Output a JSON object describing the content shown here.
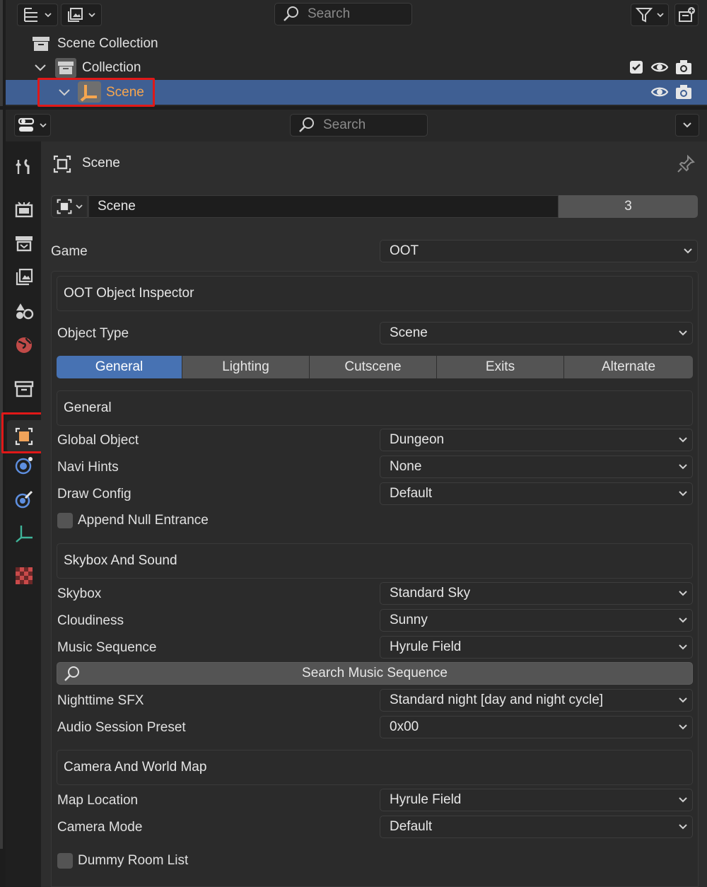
{
  "outliner": {
    "search_placeholder": "Search",
    "tree": [
      {
        "label": "Scene Collection"
      },
      {
        "label": "Collection"
      },
      {
        "label": "Scene"
      }
    ]
  },
  "properties": {
    "search_placeholder": "Search",
    "context_title": "Scene",
    "datablock": {
      "name": "Scene",
      "users": "3"
    },
    "game": {
      "label": "Game",
      "value": "OOT"
    },
    "inspector": {
      "title": "OOT Object Inspector",
      "object_type": {
        "label": "Object Type",
        "value": "Scene"
      },
      "tabs": [
        "General",
        "Lighting",
        "Cutscene",
        "Exits",
        "Alternate"
      ],
      "active_tab": "General"
    },
    "general": {
      "title": "General",
      "global_object": {
        "label": "Global Object",
        "value": "Dungeon"
      },
      "navi_hints": {
        "label": "Navi Hints",
        "value": "None"
      },
      "draw_config": {
        "label": "Draw Config",
        "value": "Default"
      },
      "append_null_entrance": {
        "label": "Append Null Entrance",
        "checked": false
      }
    },
    "skybox_sound": {
      "title": "Skybox And Sound",
      "skybox": {
        "label": "Skybox",
        "value": "Standard Sky"
      },
      "cloudiness": {
        "label": "Cloudiness",
        "value": "Sunny"
      },
      "music_sequence": {
        "label": "Music Sequence",
        "value": "Hyrule Field"
      },
      "search_music_button": "Search Music Sequence",
      "nighttime_sfx": {
        "label": "Nighttime SFX",
        "value": "Standard night [day and night cycle]"
      },
      "audio_session_preset": {
        "label": "Audio Session Preset",
        "value": "0x00"
      }
    },
    "camera_world_map": {
      "title": "Camera And World Map",
      "map_location": {
        "label": "Map Location",
        "value": "Hyrule Field"
      },
      "camera_mode": {
        "label": "Camera Mode",
        "value": "Default"
      }
    },
    "dummy_room_list": {
      "label": "Dummy Room List",
      "checked": false
    }
  },
  "colors": {
    "selection": "#3f5f93",
    "active_tab": "#4772b3",
    "highlight_red": "#e01818",
    "scene_label": "#f7a64f"
  }
}
